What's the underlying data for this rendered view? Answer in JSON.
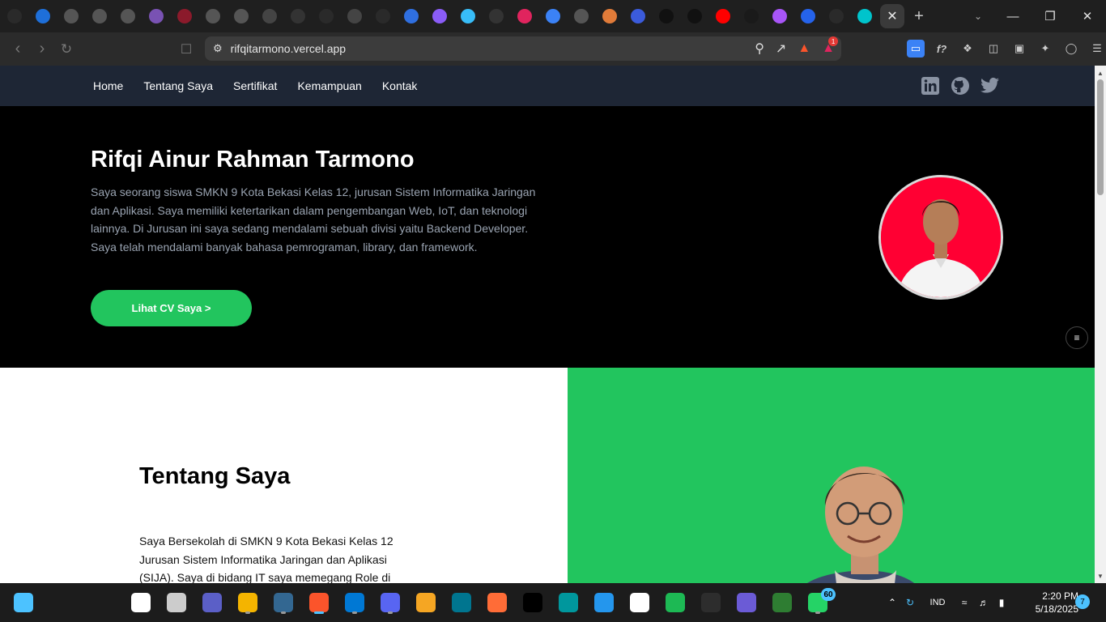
{
  "browser": {
    "tabs": [
      {
        "icon": "github-icon",
        "color": "#2a2a2a"
      },
      {
        "icon": "shield-badge-icon",
        "color": "#1e6fd9"
      },
      {
        "icon": "globe-icon",
        "color": "#555555"
      },
      {
        "icon": "globe-icon",
        "color": "#555555"
      },
      {
        "icon": "globe-icon",
        "color": "#555555"
      },
      {
        "icon": "bootstrap-icon",
        "color": "#7952b3"
      },
      {
        "icon": "heart-icon",
        "color": "#8b1a2b"
      },
      {
        "icon": "globe-icon",
        "color": "#555555"
      },
      {
        "icon": "globe-icon",
        "color": "#555555"
      },
      {
        "icon": "chat-icon",
        "color": "#444444"
      },
      {
        "icon": "openai-icon",
        "color": "#333333"
      },
      {
        "icon": "github-icon",
        "color": "#2a2a2a"
      },
      {
        "icon": "chat-icon",
        "color": "#444444"
      },
      {
        "icon": "github-icon",
        "color": "#2a2a2a"
      },
      {
        "icon": "square-app-icon",
        "color": "#2f6fe0"
      },
      {
        "icon": "vite-icon",
        "color": "#8a5cf6"
      },
      {
        "icon": "tailwind-icon",
        "color": "#38bdf8"
      },
      {
        "icon": "slash-icon",
        "color": "#333333"
      },
      {
        "icon": "swirl-icon",
        "color": "#e0245e"
      },
      {
        "icon": "chevron-badge-icon",
        "color": "#3b82f6"
      },
      {
        "icon": "globe-icon",
        "color": "#555555"
      },
      {
        "icon": "dev-avatar-icon",
        "color": "#e07b39"
      },
      {
        "icon": "shield-blue-icon",
        "color": "#3b5bdb"
      },
      {
        "icon": "triangle-icon",
        "color": "#111111"
      },
      {
        "icon": "triangle-icon",
        "color": "#111111"
      },
      {
        "icon": "youtube-icon",
        "color": "#ff0000"
      },
      {
        "icon": "dark-app-icon",
        "color": "#1a1a1a"
      },
      {
        "icon": "vite-icon",
        "color": "#a855f7"
      },
      {
        "icon": "app-blue-icon",
        "color": "#2563eb"
      },
      {
        "icon": "github-icon",
        "color": "#2a2a2a"
      },
      {
        "icon": "canva-icon",
        "color": "#00c4cc"
      }
    ],
    "active_tab_close": "✕",
    "new_tab": "+",
    "url": "rifqitarmono.vercel.app",
    "brave_badge_count": "1"
  },
  "site": {
    "nav": [
      "Home",
      "Tentang Saya",
      "Sertifikat",
      "Kemampuan",
      "Kontak"
    ],
    "social": [
      "linkedin-icon",
      "github-icon",
      "twitter-icon"
    ],
    "hero": {
      "name": "Rifqi Ainur Rahman Tarmono",
      "bio": "Saya seorang siswa SMKN 9 Kota Bekasi Kelas 12, jurusan Sistem Informatika Jaringan dan Aplikasi. Saya memiliki ketertarikan dalam pengembangan Web, IoT, dan teknologi lainnya. Di Jurusan ini saya sedang mendalami sebuah divisi yaitu Backend Developer. Saya telah mendalami banyak bahasa pemrograman, library, dan framework.",
      "cv_button": "Lihat CV Saya >"
    },
    "about": {
      "title": "Tentang Saya",
      "text": "Saya Bersekolah di SMKN 9 Kota Bekasi Kelas 12 Jurusan Sistem Informatika Jaringan dan Aplikasi (SIJA). Saya di bidang IT saya memegang Role di"
    },
    "colors": {
      "accent": "#22c55e",
      "nav_bg": "#1e2635",
      "avatar_bg": "#ff0033"
    }
  },
  "taskbar": {
    "apps": [
      {
        "name": "start-icon",
        "color": "#4cc2ff"
      },
      {
        "name": "search-icon",
        "color": "#ffffff"
      },
      {
        "name": "task-view-icon",
        "color": "#cccccc"
      },
      {
        "name": "video-call-icon",
        "color": "#5b5fc7"
      },
      {
        "name": "file-explorer-icon",
        "color": "#f4b400"
      },
      {
        "name": "postgres-icon",
        "color": "#336791"
      },
      {
        "name": "brave-icon",
        "color": "#fb542b"
      },
      {
        "name": "vscode-icon",
        "color": "#0078d4"
      },
      {
        "name": "discord-icon",
        "color": "#5865f2"
      },
      {
        "name": "duck-icon",
        "color": "#f5a623"
      },
      {
        "name": "mysql-icon",
        "color": "#00758f"
      },
      {
        "name": "postman-icon",
        "color": "#ff6c37"
      },
      {
        "name": "jetbrains-icon",
        "color": "#000000"
      },
      {
        "name": "arduino-icon",
        "color": "#00979d"
      },
      {
        "name": "docker-icon",
        "color": "#2496ed"
      },
      {
        "name": "notion-icon",
        "color": "#ffffff"
      },
      {
        "name": "spotify-icon",
        "color": "#1db954"
      },
      {
        "name": "terminal-icon",
        "color": "#2d2d2d"
      },
      {
        "name": "notes-icon",
        "color": "#6b5bd6"
      },
      {
        "name": "green-app-icon",
        "color": "#2e7d32"
      },
      {
        "name": "whatsapp-icon",
        "color": "#25d366"
      }
    ],
    "whatsapp_badge": "60",
    "language": "IND",
    "time": "2:20 PM",
    "date": "5/18/2025",
    "notification_count": "7"
  }
}
